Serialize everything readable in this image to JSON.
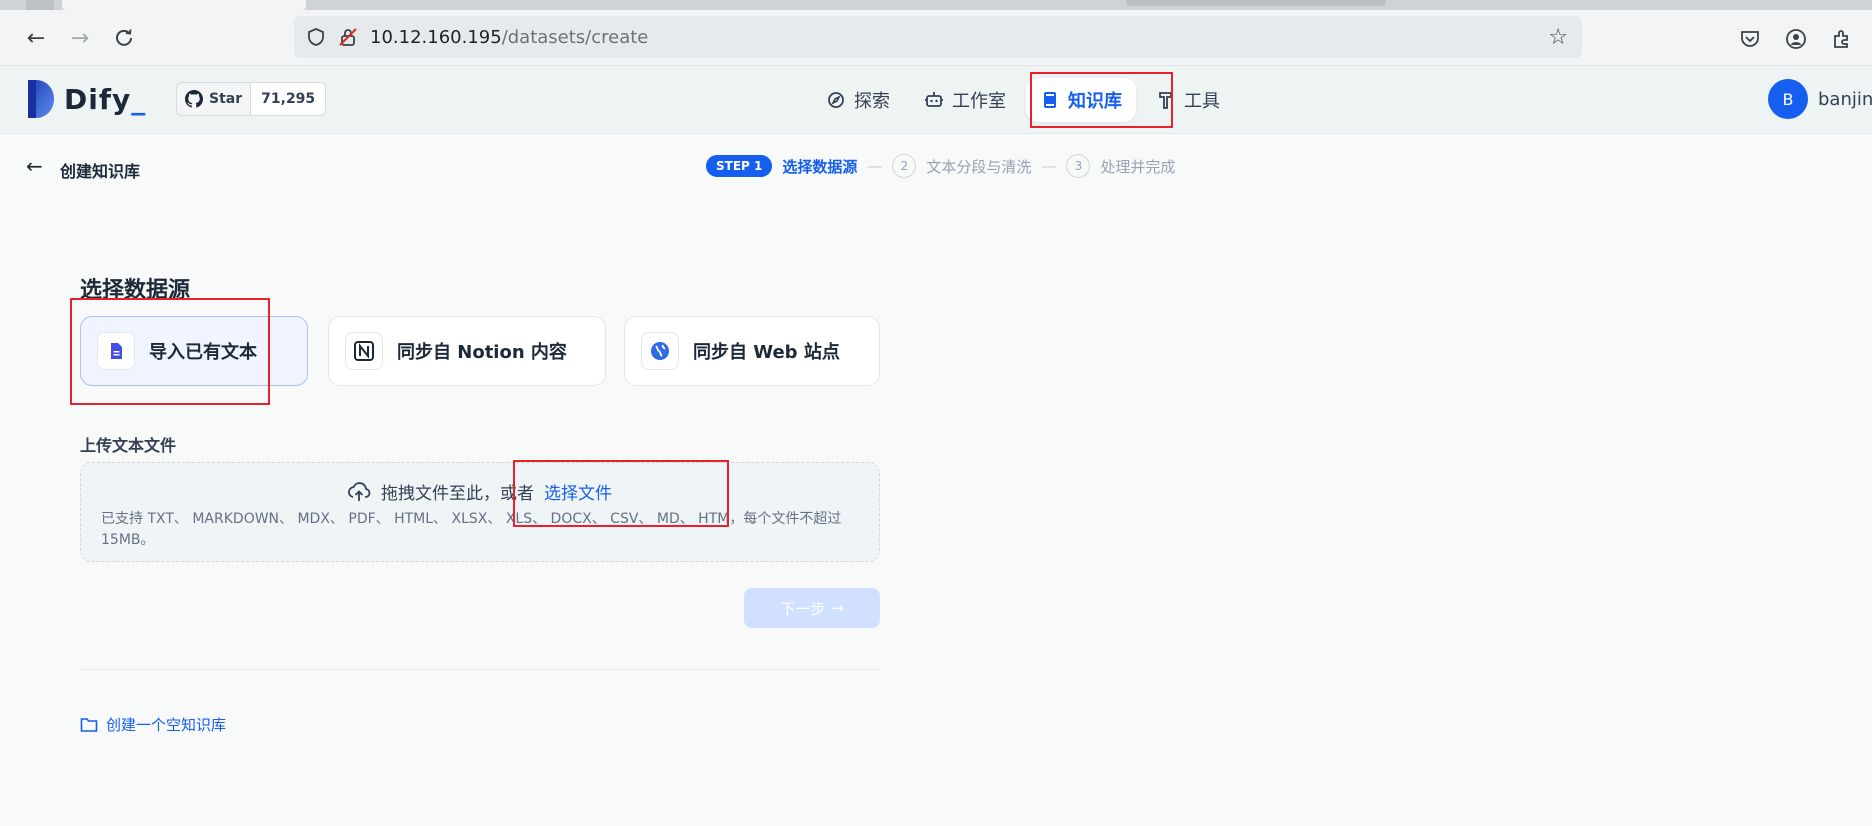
{
  "browser": {
    "url_host": "10.12.160.195",
    "url_path": "/datasets/create"
  },
  "header": {
    "logo_text": "Dify",
    "github": {
      "label": "Star",
      "count": "71,295"
    },
    "nav": [
      {
        "label": "探索",
        "icon": "explore-icon"
      },
      {
        "label": "工作室",
        "icon": "robot-icon"
      },
      {
        "label": "知识库",
        "icon": "book-icon",
        "active": true
      },
      {
        "label": "工具",
        "icon": "hammer-icon"
      }
    ],
    "user": {
      "initial": "B",
      "name": "banjin"
    }
  },
  "subheader": {
    "title": "创建知识库",
    "steps": [
      {
        "badge": "STEP 1",
        "label": "选择数据源",
        "active": true
      },
      {
        "num": "2",
        "label": "文本分段与清洗"
      },
      {
        "num": "3",
        "label": "处理并完成"
      }
    ]
  },
  "content": {
    "section_title": "选择数据源",
    "sources": [
      {
        "label": "导入已有文本",
        "icon": "file-text-icon",
        "selected": true
      },
      {
        "label": "同步自 Notion 内容",
        "icon": "notion-icon"
      },
      {
        "label": "同步自 Web 站点",
        "icon": "web-globe-icon"
      }
    ],
    "upload_label": "上传文本文件",
    "drop_text": "拖拽文件至此，或者",
    "drop_link": "选择文件",
    "drop_hint": "已支持 TXT、 MARKDOWN、 MDX、 PDF、 HTML、 XLSX、 XLS、 DOCX、 CSV、 MD、 HTM，每个文件不超过 15MB。",
    "next_button": "下一步",
    "create_empty": "创建一个空知识库"
  },
  "colors": {
    "accent": "#155eef",
    "annotation": "#e8212d"
  }
}
